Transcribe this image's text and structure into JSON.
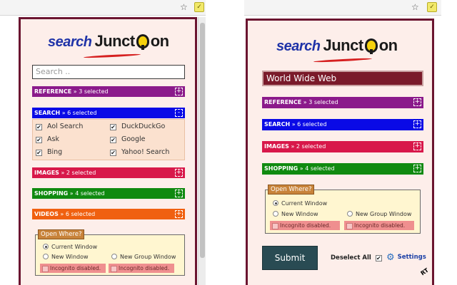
{
  "colors": {
    "popup_border": "#6b1530",
    "popup_bg": "#fdeeea",
    "reference": "#8b1a8b",
    "search": "#0a0ae6",
    "images": "#d8184a",
    "shopping": "#108a10",
    "videos": "#f06010",
    "submit": "#294b53"
  },
  "browser": {
    "star_icon": "☆",
    "extension_icon": "puzzle-extension-icon"
  },
  "logo": {
    "word1": "search",
    "word2": "Junct",
    "word3": "on"
  },
  "left": {
    "search_placeholder": "Search ..",
    "categories": {
      "reference": {
        "name": "REFERENCE",
        "sep": " » ",
        "count": "3 selected",
        "toggle": "+"
      },
      "search": {
        "name": "SEARCH",
        "sep": " » ",
        "count": "6 selected",
        "toggle": "-"
      },
      "images": {
        "name": "IMAGES",
        "sep": " » ",
        "count": "2 selected",
        "toggle": "+"
      },
      "shopping": {
        "name": "SHOPPING",
        "sep": " » ",
        "count": "4 selected",
        "toggle": "+"
      },
      "videos": {
        "name": "VIDEOS",
        "sep": " » ",
        "count": "6 selected",
        "toggle": "+"
      }
    },
    "engines": [
      {
        "label": "Aol Search",
        "checked": "✔"
      },
      {
        "label": "DuckDuckGo",
        "checked": "✔"
      },
      {
        "label": "Ask",
        "checked": "✔"
      },
      {
        "label": "Google",
        "checked": "✔"
      },
      {
        "label": "Bing",
        "checked": "✔"
      },
      {
        "label": "Yahoo! Search",
        "checked": "✔"
      }
    ],
    "open_where": {
      "legend": "Open Where?",
      "current_window": "Current Window",
      "new_window": "New Window",
      "new_group_window": "New Group Window",
      "incognito1": "Incognito disabled.",
      "incognito2": "Incognito disabled."
    }
  },
  "right": {
    "search_value": "World Wide Web",
    "categories": {
      "reference": {
        "name": "REFERENCE",
        "sep": " » ",
        "count": "3 selected",
        "toggle": "+"
      },
      "search": {
        "name": "SEARCH",
        "sep": " » ",
        "count": "6 selected",
        "toggle": "+"
      },
      "images": {
        "name": "IMAGES",
        "sep": " » ",
        "count": "2 selected",
        "toggle": "+"
      },
      "shopping": {
        "name": "SHOPPING",
        "sep": " » ",
        "count": "4 selected",
        "toggle": "+"
      }
    },
    "open_where": {
      "legend": "Open Where?",
      "current_window": "Current Window",
      "new_window": "New Window",
      "new_group_window": "New Group Window",
      "incognito1": "Incognito disabled.",
      "incognito2": "Incognito disabled."
    },
    "submit": "Submit",
    "deselect_all": "Deselect All",
    "deselect_check": "✔",
    "settings": "Settings",
    "gear": "⚙",
    "signature": "RT"
  }
}
